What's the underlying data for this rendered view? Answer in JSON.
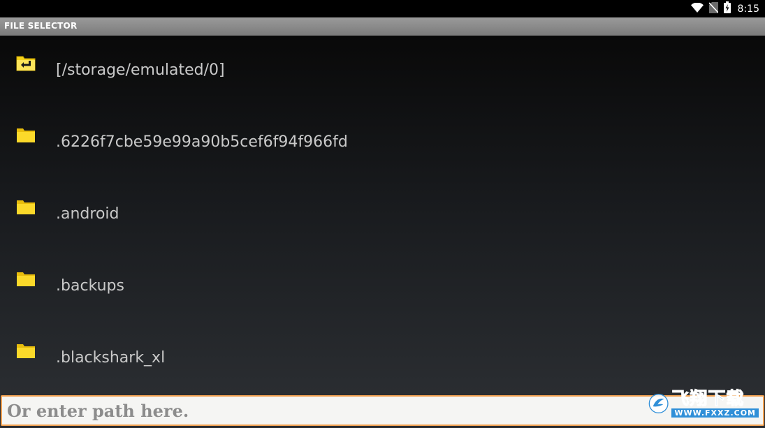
{
  "status_bar": {
    "time": "8:15",
    "icons": [
      "wifi-icon",
      "no-sim-icon",
      "battery-charging-icon"
    ]
  },
  "header": {
    "title": "FILE SELECTOR"
  },
  "file_list": {
    "items": [
      {
        "label": "[/storage/emulated/0]",
        "icon": "folder-up-icon"
      },
      {
        "label": ".6226f7cbe59e99a90b5cef6f94f966fd",
        "icon": "folder-icon"
      },
      {
        "label": ".android",
        "icon": "folder-icon"
      },
      {
        "label": ".backups",
        "icon": "folder-icon"
      },
      {
        "label": ".blackshark_xl",
        "icon": "folder-icon"
      }
    ]
  },
  "path_input": {
    "placeholder": "Or enter path here.",
    "value": ""
  },
  "watermark": {
    "text_cn": "飞翔下载",
    "url": "WWW.FXXZ.COM"
  },
  "colors": {
    "folder": "#f5d21b",
    "input_border": "#f0a050",
    "titlebar": "#8a8a8a"
  }
}
